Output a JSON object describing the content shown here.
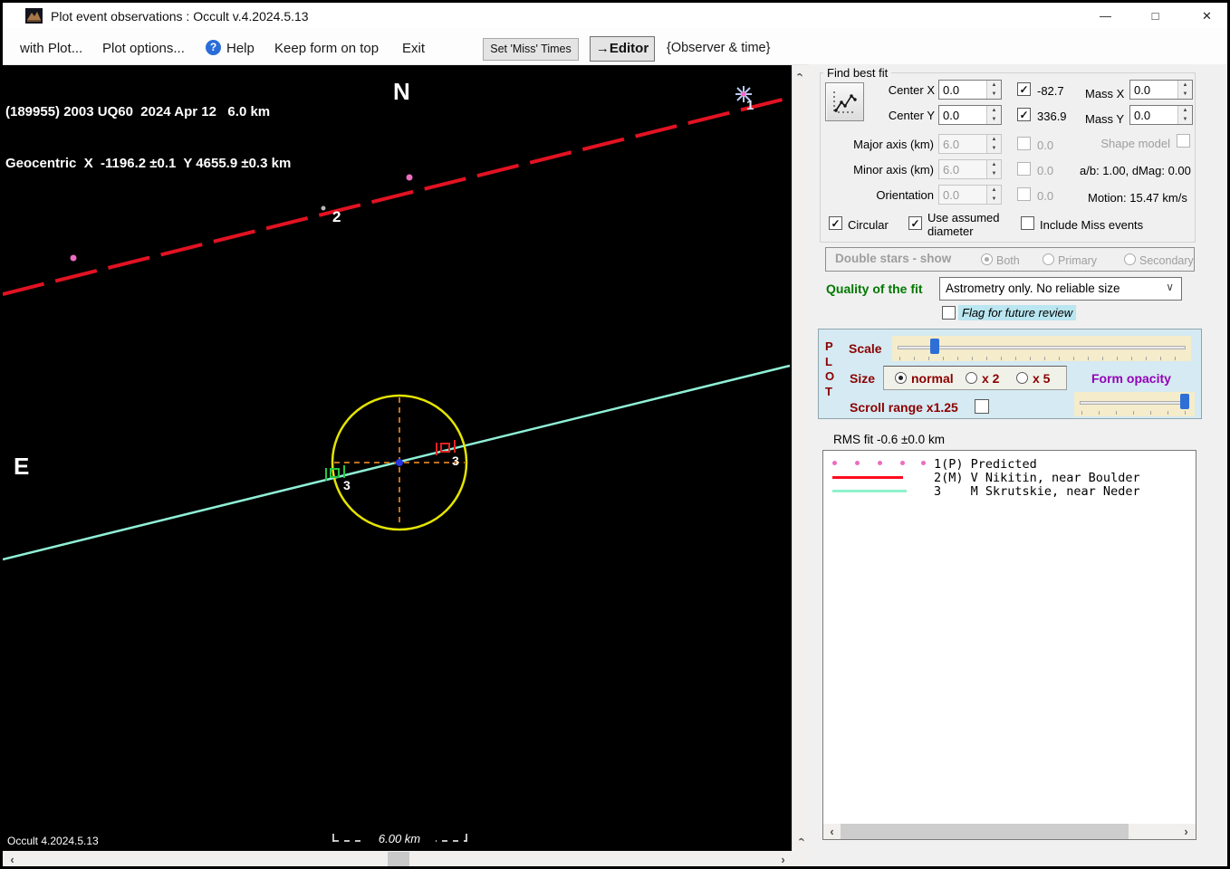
{
  "window": {
    "title": "Plot event observations : Occult v.4.2024.5.13",
    "minimize": "—",
    "maximize": "□",
    "close": "✕"
  },
  "icons": {
    "help": "?",
    "spin_up": "▲",
    "spin_down": "▼",
    "check": "✓",
    "chevron_left": "‹",
    "chevron_right": "›",
    "dropdown": "∨"
  },
  "menu": {
    "with_plot": "with Plot...",
    "plot_options": "Plot options...",
    "help": "Help",
    "keep_on_top": "Keep form on top",
    "exit": "Exit",
    "set_miss_times": "Set 'Miss' Times",
    "editor": "→Editor",
    "observer_time": "{Observer & time}"
  },
  "plot": {
    "line1": "(189955) 2003 UQ60  2024 Apr 12   6.0 km",
    "line2": "Geocentric  X  -1196.2 ±0.1  Y 4655.9 ±0.3 km",
    "north": "N",
    "east": "E",
    "marker_predicted": "1",
    "marker_chord2": "2",
    "marker_chord3_in": "3",
    "marker_chord3_out": "3",
    "scale_bar": "6.00 km",
    "version": "Occult 4.2024.5.13"
  },
  "fit": {
    "group": "Find best fit",
    "center_x_label": "Center X",
    "center_x": "0.0",
    "center_y_label": "Center Y",
    "center_y": "0.0",
    "major_label": "Major axis (km)",
    "major": "6.0",
    "minor_label": "Minor axis (km)",
    "minor": "6.0",
    "orient_label": "Orientation",
    "orient": "0.0",
    "cx_fit": "-82.7",
    "cy_fit": "336.9",
    "major_fit": "0.0",
    "minor_fit": "0.0",
    "orient_fit": "0.0",
    "mass_x_label": "Mass X",
    "mass_x": "0.0",
    "mass_y_label": "Mass Y",
    "mass_y": "0.0",
    "shape_model": "Shape model",
    "ab_dmag": "a/b: 1.00, dMag: 0.00",
    "motion": "Motion: 15.47 km/s",
    "circular": "Circular",
    "use_assumed": "Use assumed diameter",
    "include_miss": "Include Miss events"
  },
  "double_stars": {
    "label": "Double stars - show",
    "both": "Both",
    "primary": "Primary",
    "secondary": "Secondary"
  },
  "quality": {
    "label": "Quality of the fit",
    "value": "Astrometry only. No reliable size",
    "flag": "Flag for future review"
  },
  "plot_panel": {
    "p": "P",
    "l": "L",
    "o": "O",
    "t": "T",
    "scale": "Scale",
    "size": "Size",
    "size_normal": "normal",
    "size_x2": "x 2",
    "size_x5": "x 5",
    "form_opacity": "Form opacity",
    "scroll_range": "Scroll range x1.25"
  },
  "rms": "RMS fit -0.6 ±0.0 km",
  "legend": {
    "rows": [
      {
        "text": "1(P) Predicted",
        "symbol": "pink-dots",
        "color": "#ee6cc0"
      },
      {
        "text": "2(M) V Nikitin, near Boulder",
        "symbol": "red-line",
        "color": "#ff0a1e"
      },
      {
        "text": "3    M Skrutskie, near Neder",
        "symbol": "mint-line",
        "color": "#8ff2cc"
      }
    ]
  },
  "colors": {
    "chord2_red": "#e31222",
    "chord3_cyan": "#8ff0d6",
    "fitted_circle_yellow": "#e4e400",
    "crosshair_orange": "#c07020",
    "center_dot_blue": "#2636e6",
    "predicted_pink": "#ee6cc0",
    "panel_blue": "#d5eaf2",
    "slider_bg": "#f4eccb",
    "slider_thumb": "#2e6fd6",
    "quality_green": "#007800",
    "dark_red": "#8b0000",
    "opacity_purple": "#9400b8",
    "flag_highlight": "#b9e6f0"
  }
}
